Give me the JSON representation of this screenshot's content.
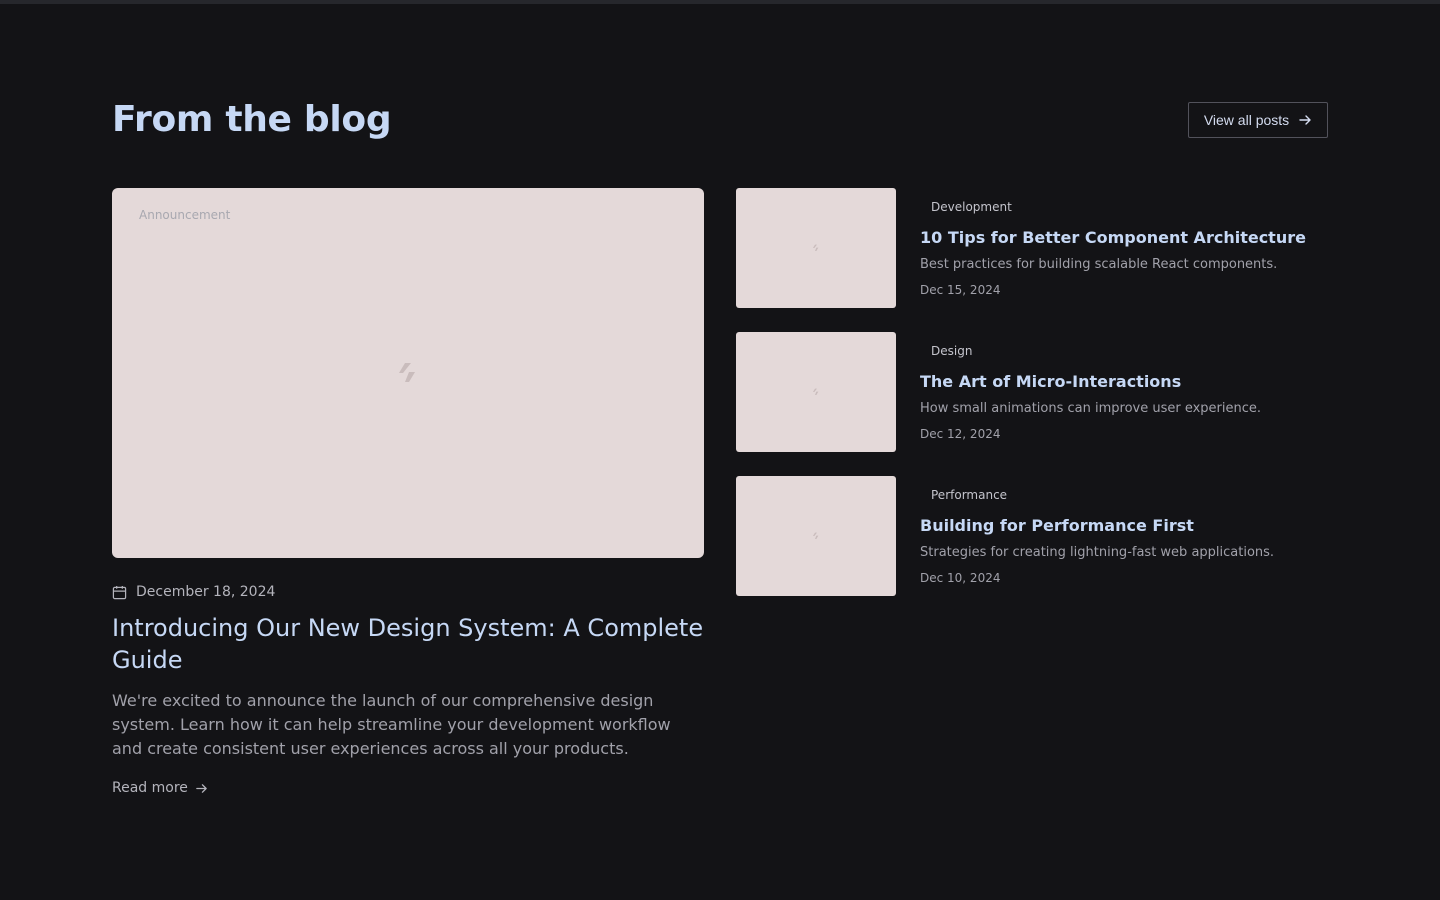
{
  "section": {
    "title": "From the blog",
    "view_all_label": "View all posts"
  },
  "featured": {
    "badge": "Announcement",
    "date": "December 18, 2024",
    "title": "Introducing Our New Design System: A Complete Guide",
    "excerpt": "We're excited to announce the launch of our comprehensive design system. Learn how it can help streamline your development workflow and create consistent user experiences across all your products.",
    "read_more_label": "Read more"
  },
  "posts": [
    {
      "category": "Development",
      "title": "10 Tips for Better Component Architecture",
      "excerpt": "Best practices for building scalable React components.",
      "date": "Dec 15, 2024"
    },
    {
      "category": "Design",
      "title": "The Art of Micro-Interactions",
      "excerpt": "How small animations can improve user experience.",
      "date": "Dec 12, 2024"
    },
    {
      "category": "Performance",
      "title": "Building for Performance First",
      "excerpt": "Strategies for creating lightning-fast web applications.",
      "date": "Dec 10, 2024"
    }
  ],
  "icons": {
    "date": "calendar-icon",
    "arrow": "arrow-right-icon",
    "image_placeholder": "image-placeholder-icon"
  },
  "colors": {
    "background": "#131316",
    "heading": "#c6d8f5",
    "image_placeholder": "#e4d9d9"
  }
}
